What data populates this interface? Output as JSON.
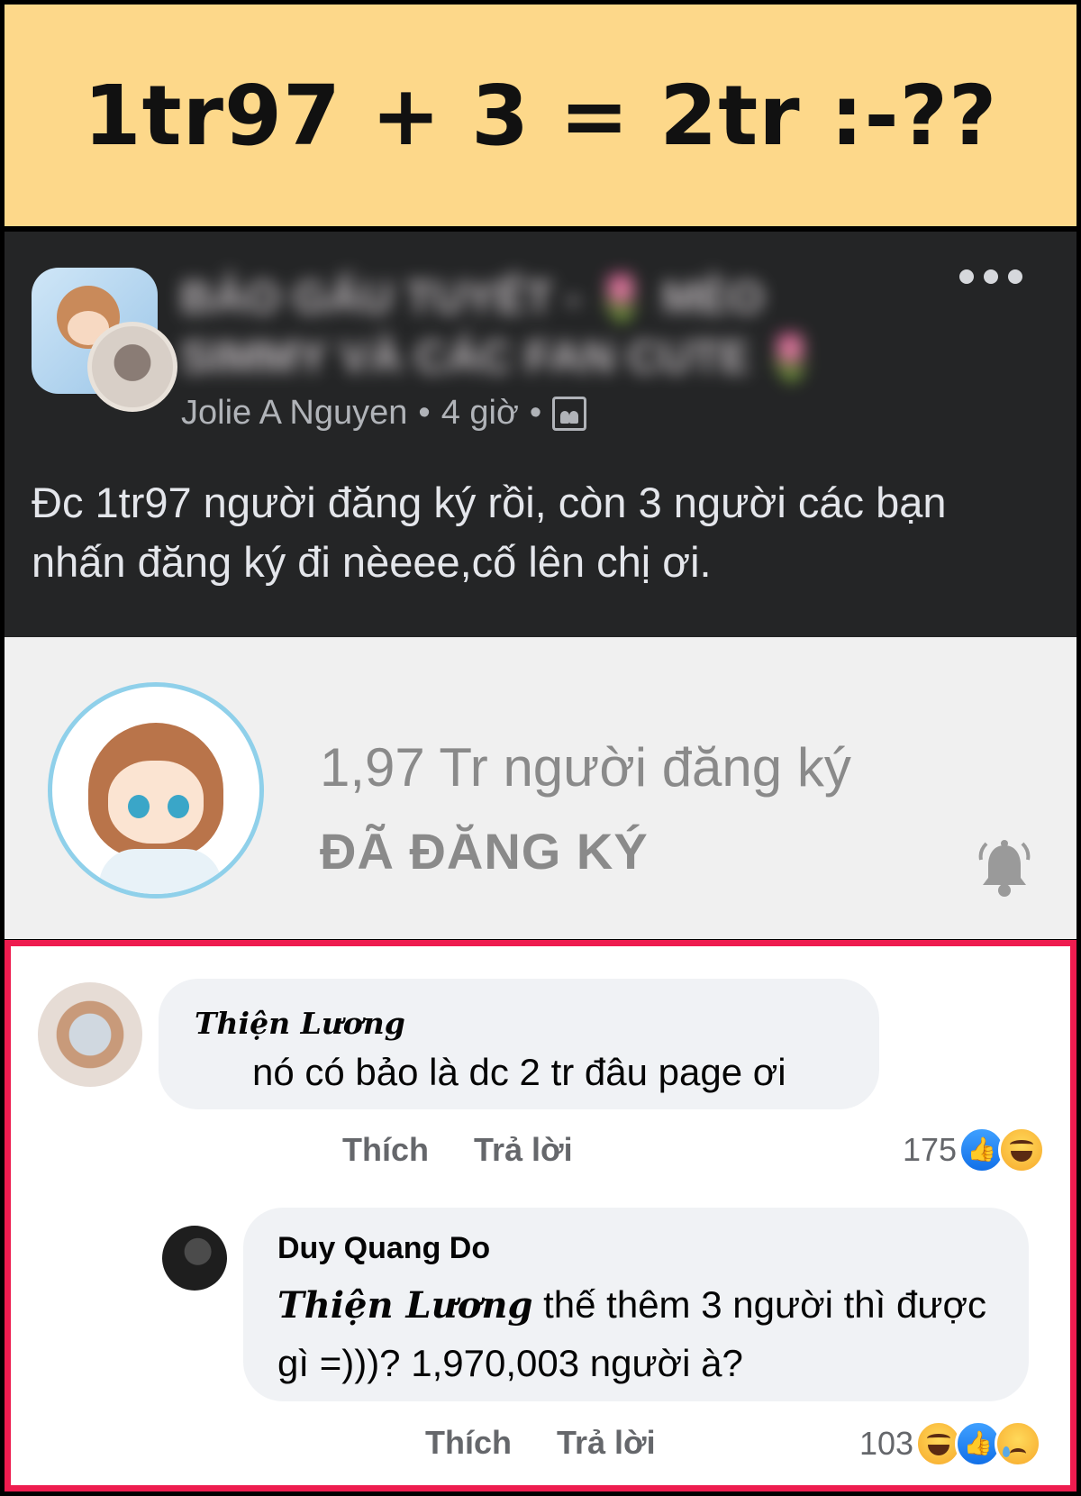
{
  "banner": {
    "headline": "1tr97 + 3 = 2tr :-??"
  },
  "post": {
    "group_name": "BẢO GẤU TUYẾT - 🌷 MÈO SIMMY VÀ CÁC FAN CUTE 🌷",
    "author": "Jolie A Nguyen",
    "separator": "•",
    "time": "4 giờ",
    "text": "Đc 1tr97 người  đăng ký rồi, còn 3 người các bạn nhấn đăng ký đi nèeee,cố lên chị ơi."
  },
  "channel_preview": {
    "subscriber_count": "1,97 Tr người đăng ký",
    "subscribed_label": "ĐÃ ĐĂNG KÝ"
  },
  "comments": [
    {
      "name": "Thiện Lương",
      "text": "nó có bảo là dc 2 tr đâu page ơi",
      "like_label": "Thích",
      "reply_label": "Trả lời",
      "reaction_count": "175",
      "reactions": [
        "like-icon",
        "haha-icon"
      ]
    },
    {
      "name": "Duy Quang Do",
      "mention": "Thiện Lương",
      "text": " thế thêm 3 người thì được gì =)))? 1,970,003 người à?",
      "like_label": "Thích",
      "reply_label": "Trả lời",
      "reaction_count": "103",
      "reactions": [
        "haha-icon",
        "like-icon",
        "sad-icon"
      ]
    }
  ],
  "colors": {
    "banner_bg": "#fdd88a",
    "post_bg": "#242526",
    "highlight_border": "#ee1c4f",
    "bubble_bg": "#f0f2f5"
  }
}
